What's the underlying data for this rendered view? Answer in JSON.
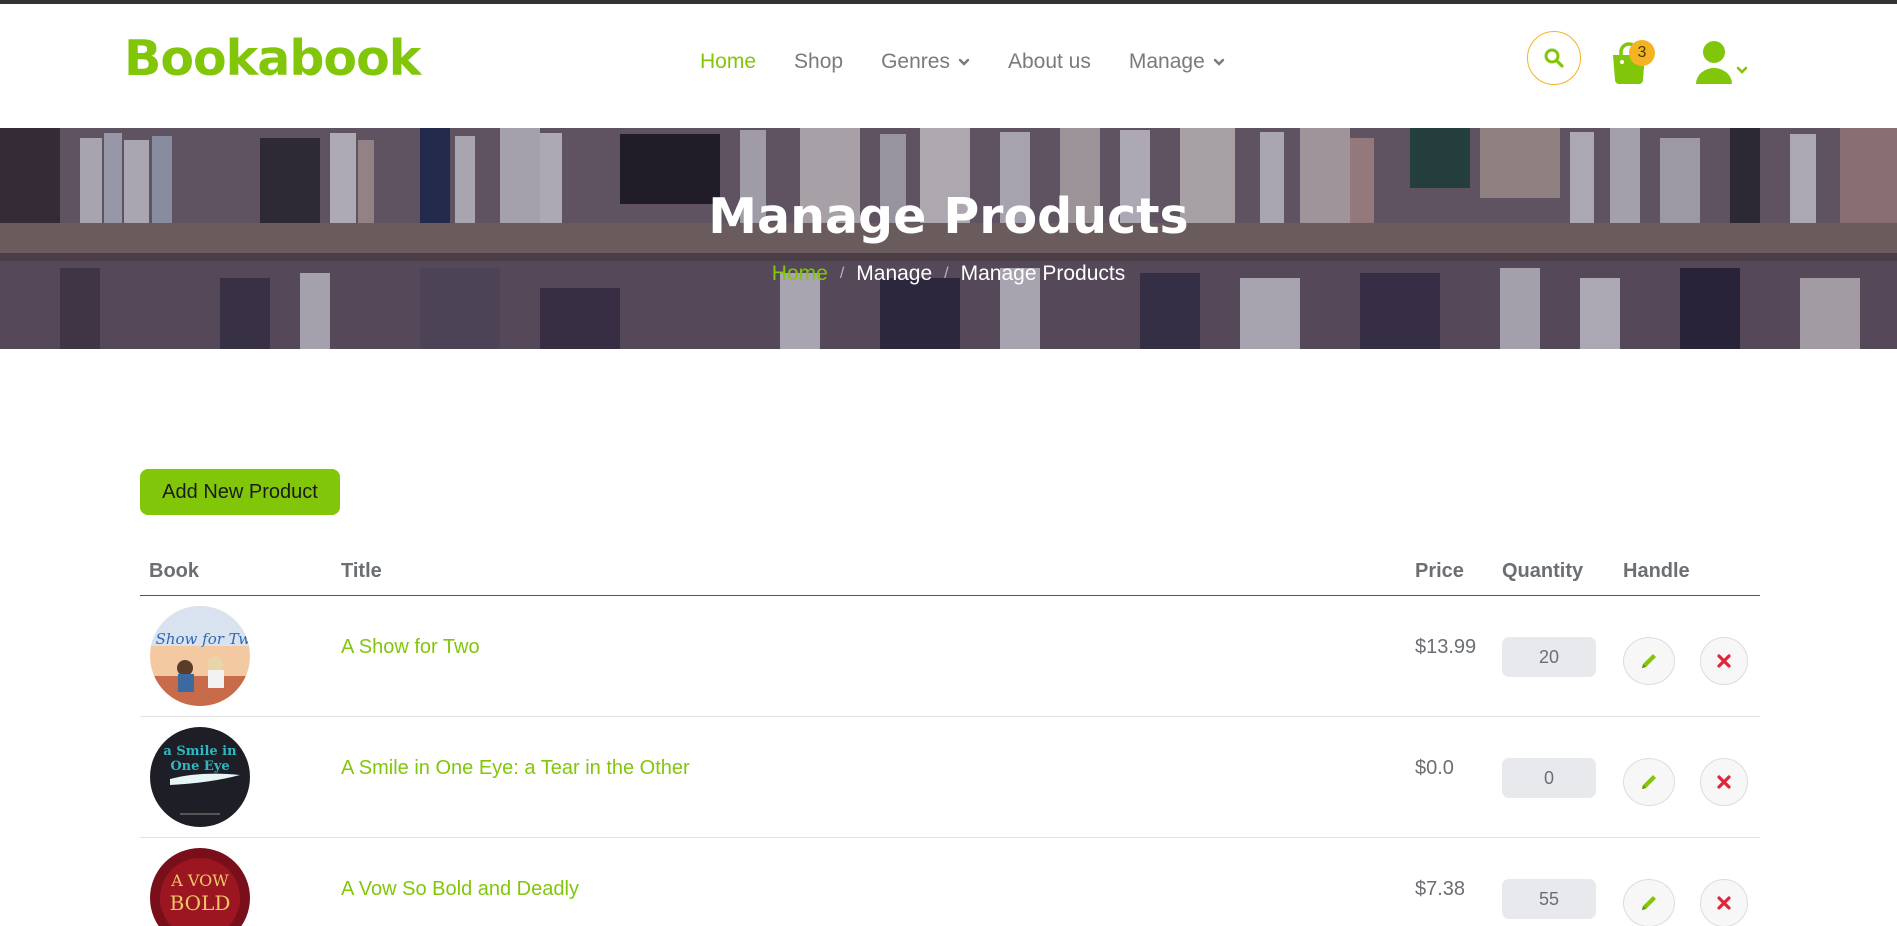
{
  "brand": {
    "name": "Bookabook",
    "accent": "#82c60a",
    "secondary": "#f5b324"
  },
  "nav": {
    "items": [
      {
        "label": "Home",
        "active": true,
        "dropdown": false
      },
      {
        "label": "Shop",
        "active": false,
        "dropdown": false
      },
      {
        "label": "Genres",
        "active": false,
        "dropdown": true
      },
      {
        "label": "About us",
        "active": false,
        "dropdown": false
      },
      {
        "label": "Manage",
        "active": false,
        "dropdown": true
      }
    ]
  },
  "header_icons": {
    "search": "search-icon",
    "cart": "shopping-bag-icon",
    "cart_count": "3",
    "user": "user-icon"
  },
  "hero": {
    "title": "Manage Products",
    "breadcrumb": [
      "Home",
      "Manage",
      "Manage Products"
    ],
    "separator": "/"
  },
  "actions": {
    "add_product_label": "Add New Product"
  },
  "table": {
    "headers": {
      "book": "Book",
      "title": "Title",
      "price": "Price",
      "quantity": "Quantity",
      "handle": "Handle"
    },
    "rows": [
      {
        "title": "A Show for Two",
        "price": "$13.99",
        "quantity": "20",
        "cover": "cover-a-show-for-two"
      },
      {
        "title": "A Smile in One Eye: a Tear in the Other",
        "price": "$0.0",
        "quantity": "0",
        "cover": "cover-a-smile-in-one-eye"
      },
      {
        "title": "A Vow So Bold and Deadly",
        "price": "$7.38",
        "quantity": "55",
        "cover": "cover-a-vow-so-bold"
      }
    ]
  },
  "covers": {
    "row0_text": "A Show for Two",
    "row1_text_line1": "a Smile in",
    "row1_text_line2": "One Eye",
    "row2_text_line1": "A VOW",
    "row2_text_line2": "BOLD"
  }
}
